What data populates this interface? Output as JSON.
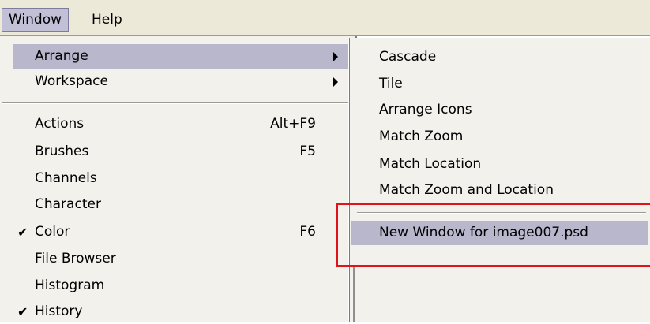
{
  "menubar": {
    "items": [
      {
        "label": "Window",
        "active": true
      },
      {
        "label": "Help",
        "active": false
      }
    ]
  },
  "window_menu": {
    "items": [
      {
        "label": "Arrange",
        "has_submenu": true,
        "highlighted": true
      },
      {
        "label": "Workspace",
        "has_submenu": true
      },
      {
        "label": "Actions",
        "shortcut": "Alt+F9"
      },
      {
        "label": "Brushes",
        "shortcut": "F5"
      },
      {
        "label": "Channels"
      },
      {
        "label": "Character"
      },
      {
        "label": "Color",
        "shortcut": "F6",
        "checked": true
      },
      {
        "label": "File Browser"
      },
      {
        "label": "Histogram"
      },
      {
        "label": "History",
        "checked": true
      }
    ]
  },
  "arrange_submenu": {
    "items": [
      {
        "label": "Cascade"
      },
      {
        "label": "Tile"
      },
      {
        "label": "Arrange Icons"
      },
      {
        "label": "Match Zoom"
      },
      {
        "label": "Match Location"
      },
      {
        "label": "Match Zoom and Location"
      },
      {
        "label": "New Window for image007.psd",
        "highlighted": true
      }
    ]
  },
  "colors": {
    "highlight": "#b8b7cc",
    "callout_border": "#e0131b",
    "menu_bg": "#f2f1ec"
  },
  "icons": {
    "check": "✔",
    "submenu_arrow": "triangle-right"
  }
}
